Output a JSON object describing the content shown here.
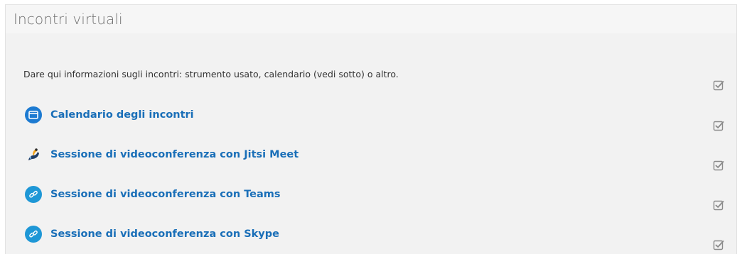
{
  "section": {
    "title": "Incontri virtuali",
    "summary": "Dare qui informazioni sugli incontri: strumento usato, calendario (vedi sotto) o altro."
  },
  "items": [
    {
      "label": "Calendario degli incontri",
      "icon": "calendar-icon",
      "color": "#1c7ad1"
    },
    {
      "label": "Sessione di videoconferenza con Jitsi Meet",
      "icon": "jitsi-icon"
    },
    {
      "label": "Sessione di videoconferenza con Teams",
      "icon": "link-icon",
      "color": "#1e97d6"
    },
    {
      "label": "Sessione di videoconferenza con Skype",
      "icon": "link-icon",
      "color": "#1e97d6"
    }
  ],
  "colors": {
    "link": "#1a6fb8",
    "checkbox": "#8a8a8a"
  }
}
